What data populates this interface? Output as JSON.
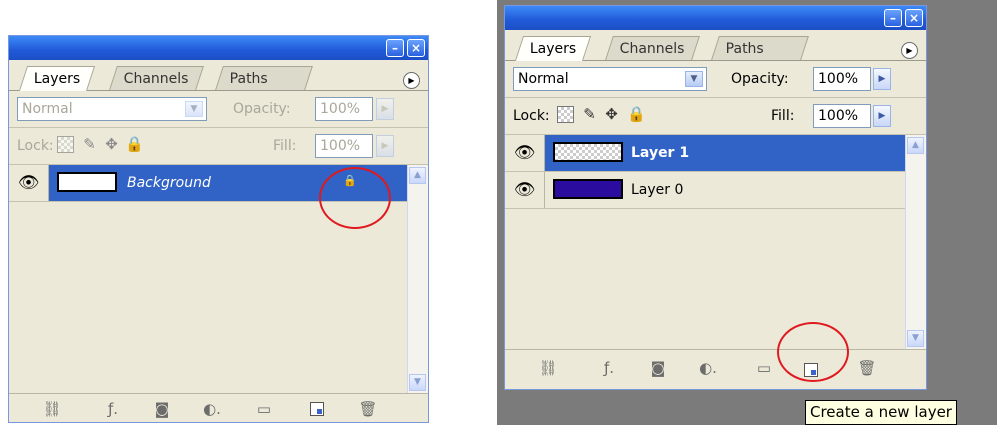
{
  "left_panel": {
    "tabs": [
      "Layers",
      "Channels",
      "Paths"
    ],
    "blend_mode": "Normal",
    "opacity_label": "Opacity:",
    "opacity_value": "100%",
    "lock_label": "Lock:",
    "fill_label": "Fill:",
    "fill_value": "100%",
    "layers": [
      {
        "name": "Background",
        "thumb_color": "#ffffff",
        "locked": true,
        "selected": true
      }
    ]
  },
  "right_panel": {
    "tabs": [
      "Layers",
      "Channels",
      "Paths"
    ],
    "blend_mode": "Normal",
    "opacity_label": "Opacity:",
    "opacity_value": "100%",
    "lock_label": "Lock:",
    "fill_label": "Fill:",
    "fill_value": "100%",
    "layers": [
      {
        "name": "Layer 1",
        "thumb": "transparent",
        "selected": true
      },
      {
        "name": "Layer 0",
        "thumb_color": "#2a0d9e",
        "selected": false
      }
    ]
  },
  "tooltip": "Create a new layer",
  "colors": {
    "accent": "#3162c5",
    "highlight_circle": "#e0191f",
    "titlebar": "#2059d8"
  }
}
